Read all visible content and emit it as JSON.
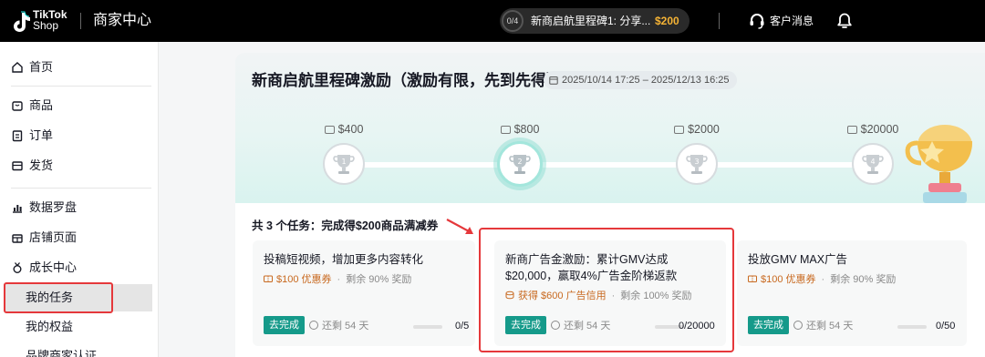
{
  "header": {
    "logo_line1": "TikTok",
    "logo_line2": "Shop",
    "title": "商家中心",
    "task_progress": "0/4",
    "task_name": "新商启航里程碑1: 分享...",
    "task_amount": "$200",
    "service_label": "客户消息"
  },
  "sidebar": {
    "items": [
      {
        "label": "首页",
        "icon": "home-icon"
      },
      {
        "label": "商品",
        "icon": "product-icon"
      },
      {
        "label": "订单",
        "icon": "order-icon"
      },
      {
        "label": "发货",
        "icon": "shipping-icon"
      },
      {
        "label": "数据罗盘",
        "icon": "analytics-icon"
      },
      {
        "label": "店铺页面",
        "icon": "store-icon"
      },
      {
        "label": "成长中心",
        "icon": "growth-icon"
      }
    ],
    "sub_items": [
      {
        "label": "我的任务",
        "active": true
      },
      {
        "label": "我的权益",
        "active": false
      },
      {
        "label": "品牌商家认证",
        "active": false
      }
    ]
  },
  "banner": {
    "title": "新商启航里程碑激励（激励有限，先到先得）",
    "date_range": "2025/10/14 17:25 – 2025/12/13 16:25",
    "milestones": [
      {
        "amount": "$400",
        "number": "1",
        "active": false
      },
      {
        "amount": "$800",
        "number": "2",
        "active": true
      },
      {
        "amount": "$2000",
        "number": "3",
        "active": false
      },
      {
        "amount": "$20000",
        "number": "4",
        "active": false
      }
    ]
  },
  "tasks": {
    "heading": "共 3 个任务：完成得$200商品满减券",
    "cards": [
      {
        "title": "投稿短视频，增加更多内容转化",
        "reward": "$100 优惠券",
        "reward_rest": "剩余 90% 奖励",
        "button": "去完成",
        "remaining": "还剩 54 天",
        "progress": "0/5",
        "progress_fraction": 0
      },
      {
        "title": "新商广告金激励：累计GMV达成 $20,000，赢取4%广告金阶梯返款",
        "reward": "获得 $600 广告信用",
        "reward_rest": "剩余 100% 奖励",
        "button": "去完成",
        "remaining": "还剩 54 天",
        "progress": "0/20000",
        "progress_fraction": 0
      },
      {
        "title": "投放GMV MAX广告",
        "reward": "$100 优惠券",
        "reward_rest": "剩余 90% 奖励",
        "button": "去完成",
        "remaining": "还剩 54 天",
        "progress": "0/50",
        "progress_fraction": 0
      }
    ]
  },
  "colors": {
    "accent": "#159a8a",
    "highlight": "#e5383b",
    "reward": "#c8691f",
    "price": "#f5b335"
  }
}
